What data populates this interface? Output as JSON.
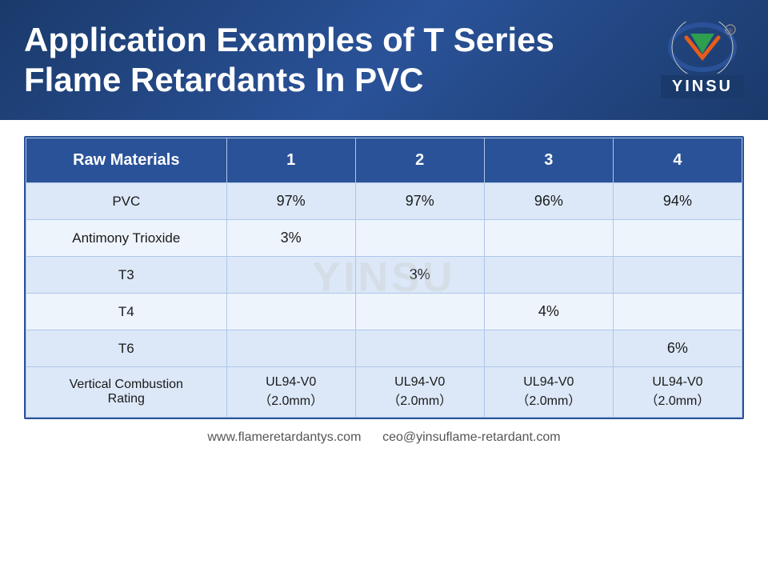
{
  "header": {
    "title_line1": "Application Examples of T Series",
    "title_line2": "Flame Retardants In PVC",
    "logo_text": "YINSU"
  },
  "table": {
    "columns": [
      "Raw Materials",
      "1",
      "2",
      "3",
      "4"
    ],
    "rows": [
      {
        "label": "PVC",
        "col1": "97%",
        "col2": "97%",
        "col3": "96%",
        "col4": "94%",
        "type": "even"
      },
      {
        "label": "Antimony Trioxide",
        "col1": "3%",
        "col2": "",
        "col3": "",
        "col4": "",
        "type": "odd"
      },
      {
        "label": "T3",
        "col1": "",
        "col2": "3%",
        "col3": "",
        "col4": "",
        "type": "even"
      },
      {
        "label": "T4",
        "col1": "",
        "col2": "",
        "col3": "4%",
        "col4": "",
        "type": "odd"
      },
      {
        "label": "T6",
        "col1": "",
        "col2": "",
        "col3": "",
        "col4": "6%",
        "type": "even"
      },
      {
        "label": "Vertical Combustion Rating",
        "col1": "UL94-V0\n（2.0mm）",
        "col2": "UL94-V0\n（2.0mm）",
        "col3": "UL94-V0\n（2.0mm）",
        "col4": "UL94-V0\n（2.0mm）",
        "type": "rating"
      }
    ]
  },
  "watermark": "YINSU",
  "footer": {
    "website": "www.flameretardantys.com",
    "email": "ceo@yinsuflame-retardant.com"
  }
}
